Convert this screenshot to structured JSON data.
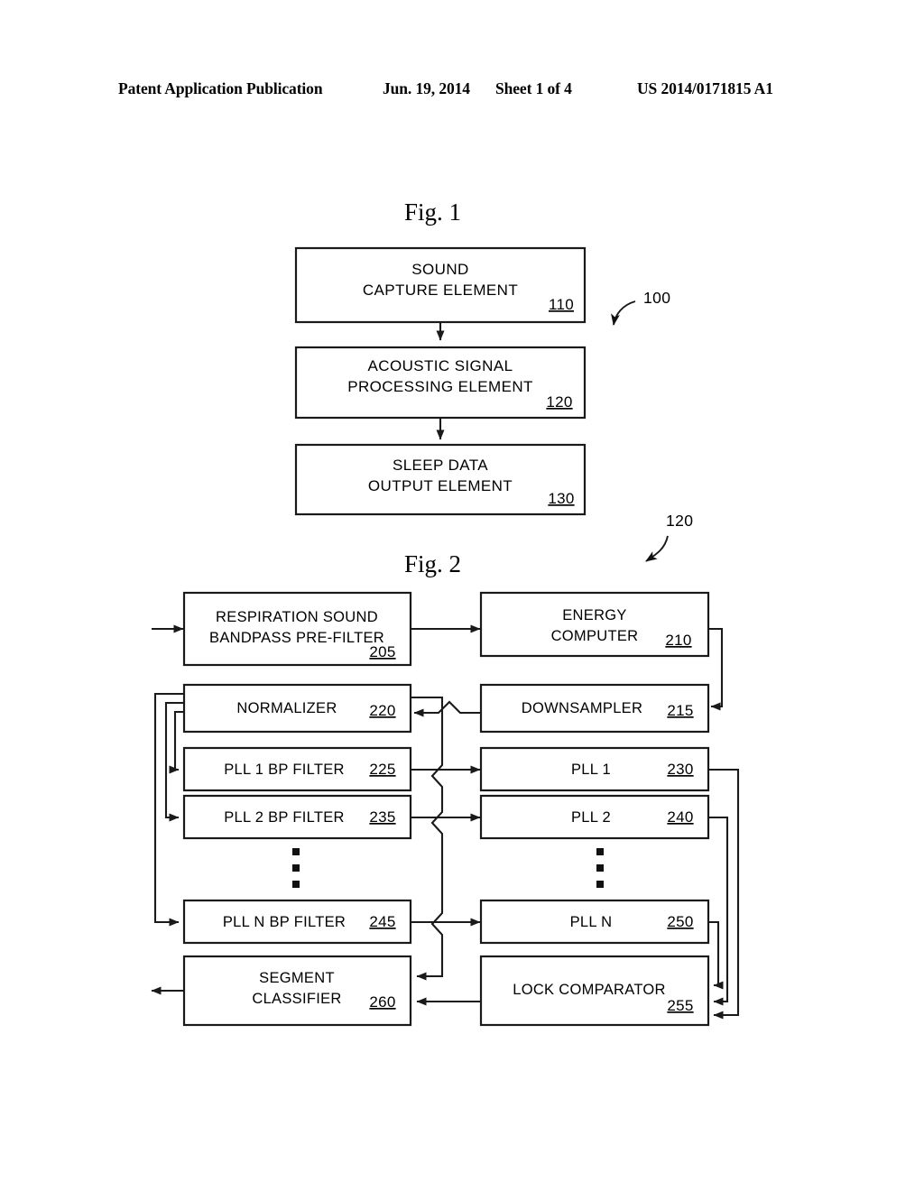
{
  "header": {
    "publication": "Patent Application Publication",
    "date": "Jun. 19, 2014",
    "sheet": "Sheet 1 of 4",
    "patent_number": "US 2014/0171815 A1"
  },
  "figures": [
    {
      "id": "fig1",
      "title": "Fig. 1",
      "callout": "100",
      "blocks": [
        {
          "id": "b110",
          "lines": [
            "SOUND",
            "CAPTURE ELEMENT"
          ],
          "ref": "110"
        },
        {
          "id": "b120",
          "lines": [
            "ACOUSTIC SIGNAL",
            "PROCESSING ELEMENT"
          ],
          "ref": "120"
        },
        {
          "id": "b130",
          "lines": [
            "SLEEP DATA",
            "OUTPUT ELEMENT"
          ],
          "ref": "130"
        }
      ]
    },
    {
      "id": "fig2",
      "title": "Fig. 2",
      "callout": "120",
      "blocks": [
        {
          "id": "b205",
          "lines": [
            "RESPIRATION SOUND",
            "BANDPASS PRE-FILTER"
          ],
          "ref": "205"
        },
        {
          "id": "b210",
          "lines": [
            "ENERGY",
            "COMPUTER"
          ],
          "ref": "210"
        },
        {
          "id": "b220",
          "lines": [
            "NORMALIZER"
          ],
          "ref": "220"
        },
        {
          "id": "b215",
          "lines": [
            "DOWNSAMPLER"
          ],
          "ref": "215"
        },
        {
          "id": "b225",
          "lines": [
            "PLL 1 BP FILTER"
          ],
          "ref": "225"
        },
        {
          "id": "b230",
          "lines": [
            "PLL 1"
          ],
          "ref": "230"
        },
        {
          "id": "b235",
          "lines": [
            "PLL 2 BP FILTER"
          ],
          "ref": "235"
        },
        {
          "id": "b240",
          "lines": [
            "PLL 2"
          ],
          "ref": "240"
        },
        {
          "id": "b245",
          "lines": [
            "PLL N BP FILTER"
          ],
          "ref": "245"
        },
        {
          "id": "b250",
          "lines": [
            "PLL N"
          ],
          "ref": "250"
        },
        {
          "id": "b260",
          "lines": [
            "SEGMENT",
            "CLASSIFIER"
          ],
          "ref": "260"
        },
        {
          "id": "b255",
          "lines": [
            "LOCK COMPARATOR"
          ],
          "ref": "255"
        }
      ],
      "ellipsis": "vertical-three-dots"
    }
  ],
  "colors": {
    "ink": "#1a1a1a",
    "paper": "#ffffff"
  }
}
